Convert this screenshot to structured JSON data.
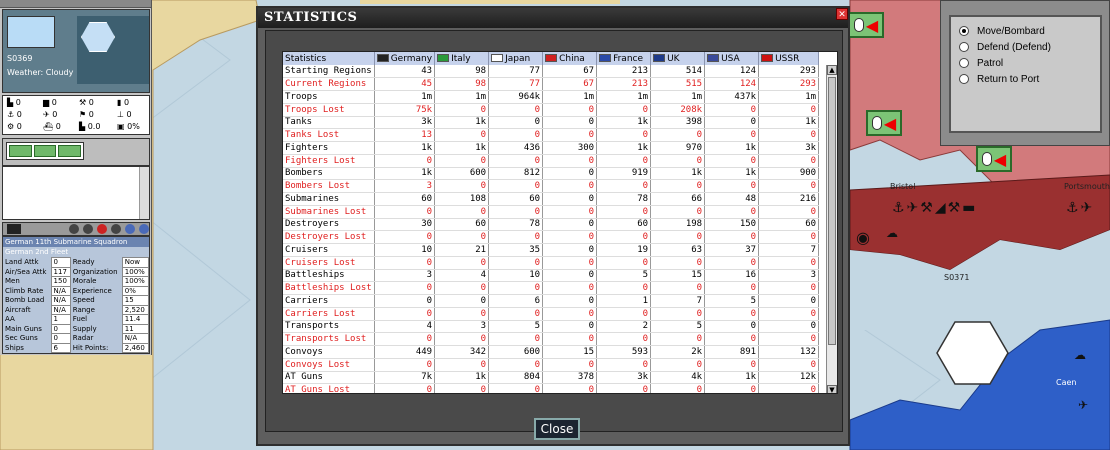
{
  "map": {
    "labels": {
      "bristol": "Bristol",
      "portsmouth": "Portsmouth",
      "province": "S0371",
      "caen": "Caen"
    }
  },
  "left_panel": {
    "province_id": "S0369",
    "weather": "Weather: Cloudy",
    "stats": [
      {
        "icon": "infantry-icon",
        "value": "0"
      },
      {
        "icon": "tank-icon",
        "value": "0"
      },
      {
        "icon": "tools-icon",
        "value": "0"
      },
      {
        "icon": "bar-icon",
        "value": "0"
      },
      {
        "icon": "anchor-icon",
        "value": "0"
      },
      {
        "icon": "plane-icon",
        "value": "0"
      },
      {
        "icon": "flag-icon",
        "value": "0"
      },
      {
        "icon": "mast-icon",
        "value": "0"
      },
      {
        "icon": "gear-icon",
        "value": "0"
      },
      {
        "icon": "ship-icon",
        "value": "0"
      },
      {
        "icon": "fort-icon",
        "value": "0.0"
      },
      {
        "icon": "percent-icon",
        "value": "0%"
      }
    ],
    "unit": {
      "name": "German 11th Submarine Squadron",
      "parent": "German 2nd Fleet",
      "rows": [
        [
          "Land Attk",
          "0",
          "Ready",
          "Now"
        ],
        [
          "Air/Sea Attk",
          "117",
          "Organization",
          "100%"
        ],
        [
          "Men",
          "150",
          "Morale",
          "100%"
        ],
        [
          "Climb Rate",
          "N/A",
          "Experience",
          "0%"
        ],
        [
          "Bomb Load",
          "N/A",
          "Speed",
          "15"
        ],
        [
          "Aircraft",
          "N/A",
          "Range",
          "2,520"
        ],
        [
          "AA",
          "1",
          "Fuel",
          "11.4"
        ],
        [
          "Main Guns",
          "0",
          "Supply",
          "11"
        ],
        [
          "Sec Guns",
          "0",
          "Radar",
          "N/A"
        ],
        [
          "Ships",
          "6",
          "Hit Points:",
          "2,460"
        ]
      ]
    }
  },
  "orders": {
    "options": [
      {
        "label": "Move/Bombard",
        "selected": true
      },
      {
        "label": "Defend (Defend)",
        "selected": false
      },
      {
        "label": "Patrol",
        "selected": false
      },
      {
        "label": "Return to Port",
        "selected": false
      }
    ]
  },
  "dialog": {
    "title": "STATISTICS",
    "close_label": "Close",
    "corner_header": "Statistics",
    "nations": [
      {
        "name": "Germany",
        "flag_color": "#222222"
      },
      {
        "name": "Italy",
        "flag_color": "#2a9a3a"
      },
      {
        "name": "Japan",
        "flag_color": "#ffffff"
      },
      {
        "name": "China",
        "flag_color": "#d02020"
      },
      {
        "name": "France",
        "flag_color": "#2b4aa8"
      },
      {
        "name": "UK",
        "flag_color": "#1e3a8a"
      },
      {
        "name": "USA",
        "flag_color": "#3a4a9a"
      },
      {
        "name": "USSR",
        "flag_color": "#cc1111"
      }
    ],
    "rows": [
      {
        "label": "Starting Regions",
        "lost": false,
        "values": [
          "43",
          "98",
          "77",
          "67",
          "213",
          "514",
          "124",
          "293"
        ]
      },
      {
        "label": "Current Regions",
        "lost": true,
        "values": [
          "45",
          "98",
          "77",
          "67",
          "213",
          "515",
          "124",
          "293"
        ]
      },
      {
        "label": "Troops",
        "lost": false,
        "values": [
          "1m",
          "1m",
          "964k",
          "1m",
          "1m",
          "1m",
          "437k",
          "1m"
        ]
      },
      {
        "label": "Troops Lost",
        "lost": true,
        "values": [
          "75k",
          "0",
          "0",
          "0",
          "0",
          "208k",
          "0",
          "0"
        ]
      },
      {
        "label": "Tanks",
        "lost": false,
        "values": [
          "3k",
          "1k",
          "0",
          "0",
          "1k",
          "398",
          "0",
          "1k"
        ]
      },
      {
        "label": "Tanks Lost",
        "lost": true,
        "values": [
          "13",
          "0",
          "0",
          "0",
          "0",
          "0",
          "0",
          "0"
        ]
      },
      {
        "label": "Fighters",
        "lost": false,
        "values": [
          "1k",
          "1k",
          "436",
          "300",
          "1k",
          "970",
          "1k",
          "3k"
        ]
      },
      {
        "label": "Fighters Lost",
        "lost": true,
        "values": [
          "0",
          "0",
          "0",
          "0",
          "0",
          "0",
          "0",
          "0"
        ]
      },
      {
        "label": "Bombers",
        "lost": false,
        "values": [
          "1k",
          "600",
          "812",
          "0",
          "919",
          "1k",
          "1k",
          "900"
        ]
      },
      {
        "label": "Bombers Lost",
        "lost": true,
        "values": [
          "3",
          "0",
          "0",
          "0",
          "0",
          "0",
          "0",
          "0"
        ]
      },
      {
        "label": "Submarines",
        "lost": false,
        "values": [
          "60",
          "108",
          "60",
          "0",
          "78",
          "66",
          "48",
          "216"
        ]
      },
      {
        "label": "Submarines Lost",
        "lost": true,
        "values": [
          "0",
          "0",
          "0",
          "0",
          "0",
          "0",
          "0",
          "0"
        ]
      },
      {
        "label": "Destroyers",
        "lost": false,
        "values": [
          "30",
          "60",
          "78",
          "0",
          "60",
          "198",
          "150",
          "60"
        ]
      },
      {
        "label": "Destroyers Lost",
        "lost": true,
        "values": [
          "0",
          "0",
          "0",
          "0",
          "0",
          "0",
          "0",
          "0"
        ]
      },
      {
        "label": "Cruisers",
        "lost": false,
        "values": [
          "10",
          "21",
          "35",
          "0",
          "19",
          "63",
          "37",
          "7"
        ]
      },
      {
        "label": "Cruisers Lost",
        "lost": true,
        "values": [
          "0",
          "0",
          "0",
          "0",
          "0",
          "0",
          "0",
          "0"
        ]
      },
      {
        "label": "Battleships",
        "lost": false,
        "values": [
          "3",
          "4",
          "10",
          "0",
          "5",
          "15",
          "16",
          "3"
        ]
      },
      {
        "label": "Battleships Lost",
        "lost": true,
        "values": [
          "0",
          "0",
          "0",
          "0",
          "0",
          "0",
          "0",
          "0"
        ]
      },
      {
        "label": "Carriers",
        "lost": false,
        "values": [
          "0",
          "0",
          "6",
          "0",
          "1",
          "7",
          "5",
          "0"
        ]
      },
      {
        "label": "Carriers Lost",
        "lost": true,
        "values": [
          "0",
          "0",
          "0",
          "0",
          "0",
          "0",
          "0",
          "0"
        ]
      },
      {
        "label": "Transports",
        "lost": false,
        "values": [
          "4",
          "3",
          "5",
          "0",
          "2",
          "5",
          "0",
          "0"
        ]
      },
      {
        "label": "Transports Lost",
        "lost": true,
        "values": [
          "0",
          "0",
          "0",
          "0",
          "0",
          "0",
          "0",
          "0"
        ]
      },
      {
        "label": "Convoys",
        "lost": false,
        "values": [
          "449",
          "342",
          "600",
          "15",
          "593",
          "2k",
          "891",
          "132"
        ]
      },
      {
        "label": "Convoys Lost",
        "lost": true,
        "values": [
          "0",
          "0",
          "0",
          "0",
          "0",
          "0",
          "0",
          "0"
        ]
      },
      {
        "label": "AT Guns",
        "lost": false,
        "values": [
          "7k",
          "1k",
          "804",
          "378",
          "3k",
          "4k",
          "1k",
          "12k"
        ]
      },
      {
        "label": "AT Guns Lost",
        "lost": true,
        "values": [
          "0",
          "0",
          "0",
          "0",
          "0",
          "0",
          "0",
          "0"
        ]
      }
    ]
  }
}
